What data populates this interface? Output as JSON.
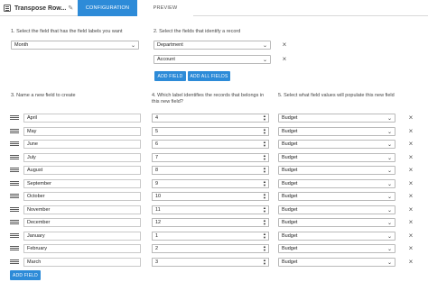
{
  "header": {
    "title": "Transpose Row...",
    "tabs": [
      "CONFIGURATION",
      "PREVIEW"
    ]
  },
  "step1": {
    "label": "1. Select the field that has the field labels you want",
    "selected": "Month"
  },
  "step2": {
    "label": "2. Select the fields that identify a record",
    "fields": [
      "Department",
      "Account"
    ],
    "add_field": "ADD FIELD",
    "add_all_fields": "ADD ALL FIELDS"
  },
  "step3": {
    "label": "3. Name a new field to create",
    "add_field": "ADD FIELD"
  },
  "step4": {
    "label": "4. Which label identifies the records that belongs in this new field?"
  },
  "step5": {
    "label": "5. Select what field values will populate this new field"
  },
  "rows": [
    {
      "name": "April",
      "label": "4",
      "value": "Budget"
    },
    {
      "name": "May",
      "label": "5",
      "value": "Budget"
    },
    {
      "name": "June",
      "label": "6",
      "value": "Budget"
    },
    {
      "name": "July",
      "label": "7",
      "value": "Budget"
    },
    {
      "name": "August",
      "label": "8",
      "value": "Budget"
    },
    {
      "name": "September",
      "label": "9",
      "value": "Budget"
    },
    {
      "name": "October",
      "label": "10",
      "value": "Budget"
    },
    {
      "name": "November",
      "label": "11",
      "value": "Budget"
    },
    {
      "name": "December",
      "label": "12",
      "value": "Budget"
    },
    {
      "name": "January",
      "label": "1",
      "value": "Budget"
    },
    {
      "name": "February",
      "label": "2",
      "value": "Budget"
    },
    {
      "name": "March",
      "label": "3",
      "value": "Budget"
    }
  ]
}
